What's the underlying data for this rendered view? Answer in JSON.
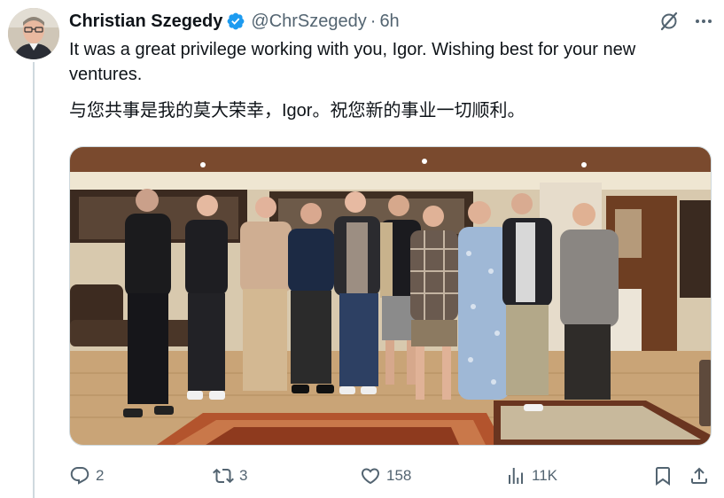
{
  "tweet": {
    "author_name": "Christian Szegedy",
    "handle": "@ChrSzegedy",
    "separator": "·",
    "time": "6h",
    "text_en": "It was a great privilege working with you, Igor. Wishing best for your new ventures.",
    "text_zh": "与您共事是我的莫大荣幸，Igor。祝您新的事业一切顺利。"
  },
  "icons": {
    "verified": "verified-badge-icon",
    "grok": "grok-icon",
    "more": "more-icon",
    "reply": "reply-icon",
    "repost": "repost-icon",
    "like": "like-icon",
    "views": "views-icon",
    "bookmark": "bookmark-icon",
    "share": "share-icon"
  },
  "actions": {
    "replies": "2",
    "reposts": "3",
    "likes": "158",
    "views": "11K"
  },
  "colors": {
    "text_primary": "#0f1419",
    "text_secondary": "#536471",
    "verified_blue": "#1d9bf0",
    "divider": "#cfd9de"
  }
}
